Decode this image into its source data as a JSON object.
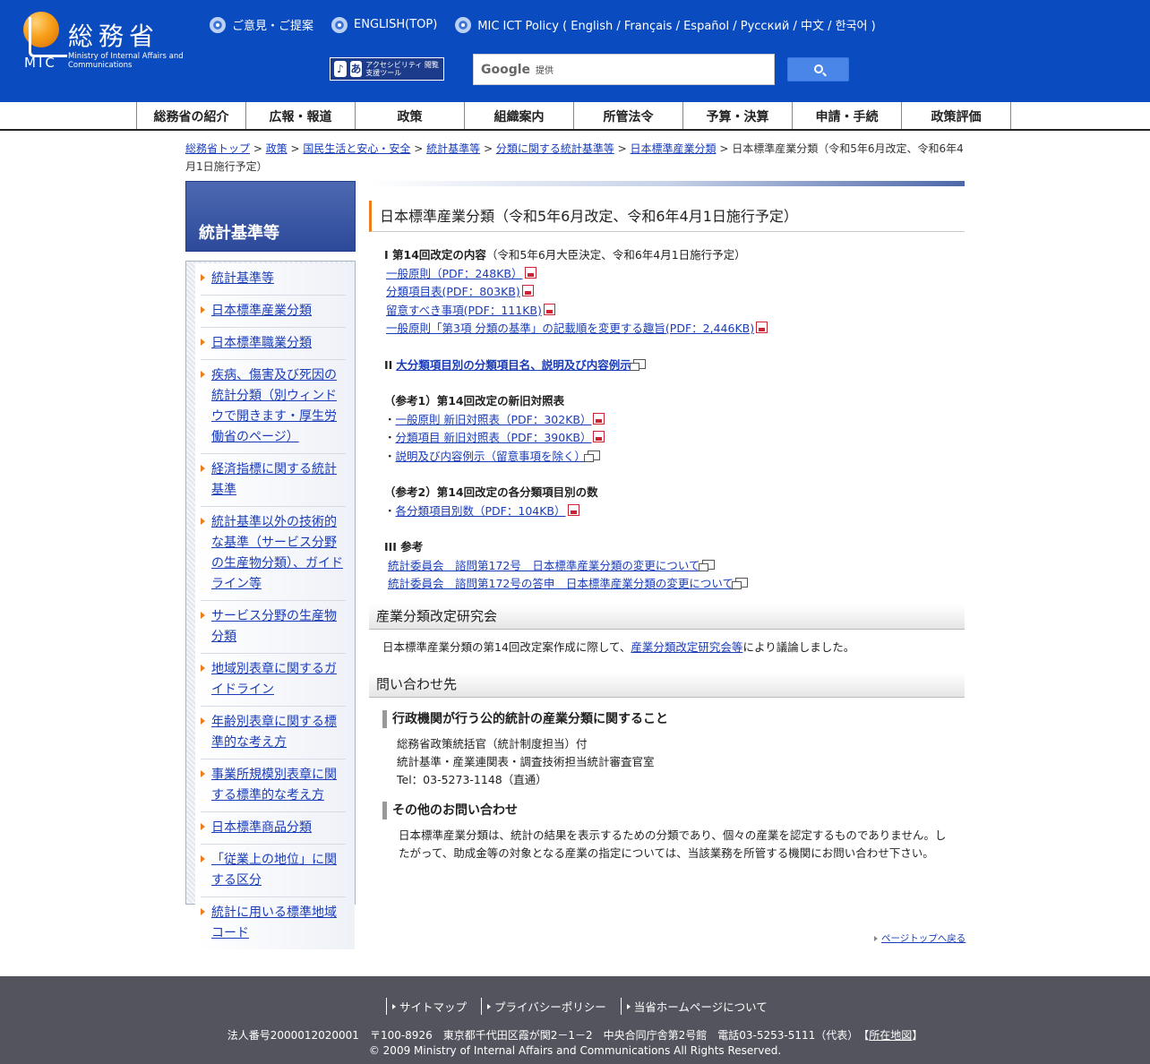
{
  "header": {
    "logo_jp": "総務省",
    "logo_mic": "MIC",
    "logo_en": "Ministry of Internal Affairs and Communications",
    "toplinks": [
      "ご意見・ご提案",
      "ENGLISH(TOP)",
      "MIC ICT Policy ( English / Français / Español / Русский / 中文 / 한국어 )"
    ],
    "access_tool": "アクセシビリティ 閲覧支援ツール",
    "search_brand": "Google",
    "search_provided": "提供"
  },
  "gnav": [
    "総務省の紹介",
    "広報・報道",
    "政策",
    "組織案内",
    "所管法令",
    "予算・決算",
    "申請・手続",
    "政策評価"
  ],
  "breadcrumb": {
    "links": [
      "総務省トップ",
      "政策",
      "国民生活と安心・安全",
      "統計基準等",
      "分類に関する統計基準等",
      "日本標準産業分類"
    ],
    "current": "日本標準産業分類（令和5年6月改定、令和6年4月1日施行予定）"
  },
  "sidebar": {
    "title": "統計基準等",
    "items": [
      "統計基準等",
      "日本標準産業分類",
      "日本標準職業分類",
      "疾病、傷害及び死因の統計分類（別ウィンドウで開きます・厚生労働省のページ）",
      "経済指標に関する統計基準",
      "統計基準以外の技術的な基準（サービス分野の生産物分類）、ガイドライン等",
      "サービス分野の生産物分類",
      "地域別表章に関するガイドライン",
      "年齢別表章に関する標準的な考え方",
      "事業所規模別表章に関する標準的な考え方",
      "日本標準商品分類",
      "「従業上の地位」に関する区分",
      "統計に用いる標準地域コード"
    ]
  },
  "main": {
    "title": "日本標準産業分類（令和5年6月改定、令和6年4月1日施行予定）",
    "sec1": {
      "heading": "I 第14回改定の内容",
      "heading_note": "（令和5年6月大臣決定、令和6年4月1日施行予定）",
      "links": [
        "一般原則（PDF：248KB）",
        "分類項目表(PDF：803KB)",
        "留意すべき事項(PDF：111KB)",
        "一般原則「第3項 分類の基準」の記載順を変更する趣旨(PDF：2,446KB)"
      ]
    },
    "sec2": {
      "label": "II",
      "link": "大分類項目別の分類項目名、説明及び内容例示"
    },
    "ref1": {
      "heading": "（参考1）第14回改定の新旧対照表",
      "links": [
        "一般原則 新旧対照表（PDF：302KB）",
        "分類項目 新旧対照表（PDF：390KB）",
        "説明及び内容例示（留意事項を除く）"
      ]
    },
    "ref2": {
      "heading": "（参考2）第14回改定の各分類項目別の数",
      "links": [
        "各分類項目別数（PDF：104KB）"
      ]
    },
    "sec3": {
      "heading": "III 参考",
      "links": [
        "統計委員会　諮問第172号　日本標準産業分類の変更について",
        "統計委員会　諮問第172号の答申　日本標準産業分類の変更について"
      ]
    },
    "study": {
      "heading": "産業分類改定研究会",
      "text_before": "日本標準産業分類の第14回改定案作成に際して、",
      "link": "産業分類改定研究会等",
      "text_after": "により議論しました。"
    },
    "contact": {
      "heading": "問い合わせ先",
      "sub1": "行政機関が行う公的統計の産業分類に関すること",
      "addr1": "総務省政策統括官（統計制度担当）付",
      "addr2": "統計基準・産業連関表・調査技術担当統計審査官室",
      "addr3": "Tel：03-5273-1148（直通）",
      "sub2": "その他のお問い合わせ",
      "note": "日本標準産業分類は、統計の結果を表示するための分類であり、個々の産業を認定するものでありません。したがって、助成金等の対象となる産業の指定については、当該業務を所管する機関にお問い合わせ下さい。"
    },
    "pagetop": "ページトップへ戻る"
  },
  "footer": {
    "links": [
      "サイトマップ",
      "プライバシーポリシー",
      "当省ホームページについて"
    ],
    "address": "法人番号2000012020001　〒100-8926　東京都千代田区霞が関2－1－2　中央合同庁舎第2号館　電話03-5253-5111（代表）",
    "map_link": "所在地図",
    "copyright": "© 2009 Ministry of Internal Affairs and Communications All Rights Reserved."
  }
}
